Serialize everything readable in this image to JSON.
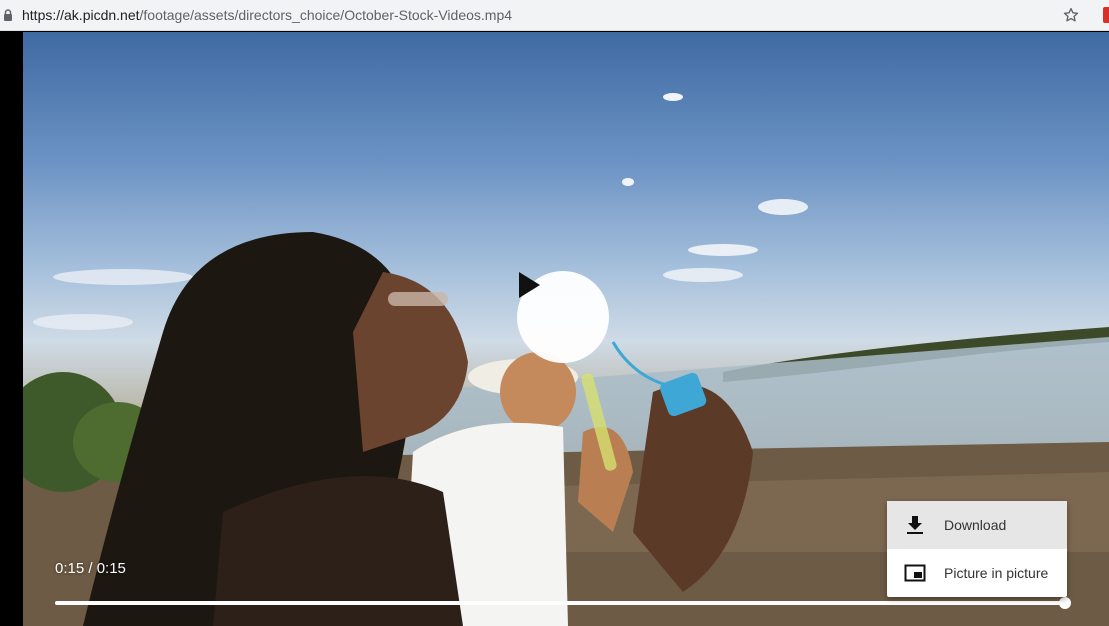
{
  "browser": {
    "url_host": "https://ak.picdn.net",
    "url_path": "/footage/assets/directors_choice/October-Stock-Videos.mp4",
    "icons": {
      "lock": "lock-icon",
      "bookmark": "star-icon",
      "extension": "extension-icon"
    }
  },
  "player": {
    "current_time": "0:15",
    "duration": "0:15",
    "time_display": "0:15 / 0:15",
    "progress": 1.0,
    "play_icon": "play-icon"
  },
  "context_menu": {
    "items": [
      {
        "label": "Download",
        "icon": "download-icon",
        "highlighted": true
      },
      {
        "label": "Picture in picture",
        "icon": "picture-in-picture-icon",
        "highlighted": false
      }
    ]
  },
  "colors": {
    "accent": "#ffffff",
    "menu_hover": "#e6e6e6",
    "extension": "#d93025"
  }
}
